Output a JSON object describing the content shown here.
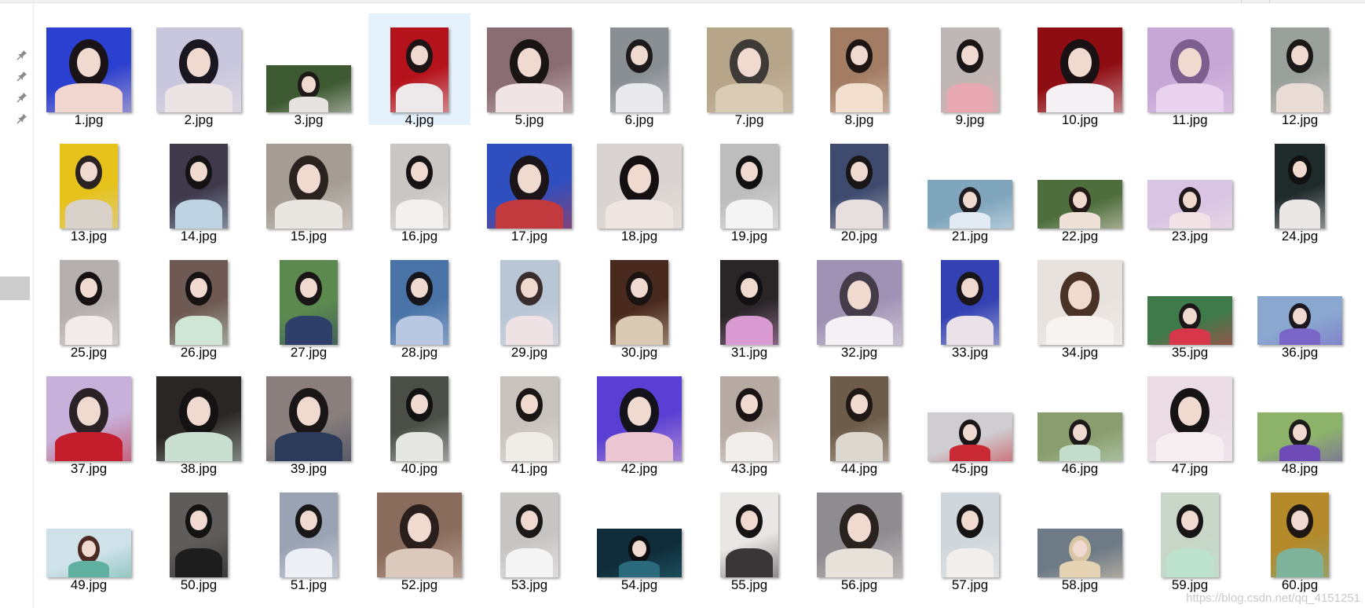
{
  "explorer": {
    "nav_pins": [
      "pin-icon",
      "pin-icon",
      "pin-icon",
      "pin-icon"
    ],
    "selected_file": "4.jpg",
    "watermark": "https://blog.csdn.net/qq_4151251"
  },
  "files": [
    {
      "name": "1.jpg",
      "shape": "sq",
      "bg": "#2b3fd0",
      "fg": "#f1d6d0",
      "hair": "#1a1418"
    },
    {
      "name": "2.jpg",
      "shape": "sq",
      "bg": "#c9c7de",
      "fg": "#ece3e4",
      "hair": "#1b1720"
    },
    {
      "name": "3.jpg",
      "shape": "land",
      "bg": "#3d5a32",
      "fg": "#e6e2df",
      "hair": "#1d1a18"
    },
    {
      "name": "4.jpg",
      "shape": "port",
      "bg": "#b5131c",
      "fg": "#ede9ea",
      "hair": "#1d1416"
    },
    {
      "name": "5.jpg",
      "shape": "sq",
      "bg": "#8a6d72",
      "fg": "#f1e4e6",
      "hair": "#1a1515"
    },
    {
      "name": "6.jpg",
      "shape": "port",
      "bg": "#8a8f93",
      "fg": "#e9e8ec",
      "hair": "#1e1a1c"
    },
    {
      "name": "7.jpg",
      "shape": "sq",
      "bg": "#b7a58a",
      "fg": "#d9cbb4",
      "hair": "#3d3a38"
    },
    {
      "name": "8.jpg",
      "shape": "port",
      "bg": "#a27c63",
      "fg": "#f2dfcf",
      "hair": "#1f1614"
    },
    {
      "name": "9.jpg",
      "shape": "port",
      "bg": "#bfb7b5",
      "fg": "#e7a8b1",
      "hair": "#1a1617"
    },
    {
      "name": "10.jpg",
      "shape": "sq",
      "bg": "#8e0d13",
      "fg": "#f4f0f4",
      "hair": "#1a1114"
    },
    {
      "name": "11.jpg",
      "shape": "sq",
      "bg": "#c7a7d6",
      "fg": "#e9d2ee",
      "hair": "#7d5f8f"
    },
    {
      "name": "12.jpg",
      "shape": "port",
      "bg": "#9aa09c",
      "fg": "#e8dcd5",
      "hair": "#1b1918"
    },
    {
      "name": "13.jpg",
      "shape": "port",
      "bg": "#e6c21a",
      "fg": "#d8d2ca",
      "hair": "#2a2321"
    },
    {
      "name": "14.jpg",
      "shape": "port",
      "bg": "#3e3a4c",
      "fg": "#bdd3e1",
      "hair": "#151214"
    },
    {
      "name": "15.jpg",
      "shape": "sq",
      "bg": "#a59d93",
      "fg": "#e9e6e2",
      "hair": "#2b2320"
    },
    {
      "name": "16.jpg",
      "shape": "port",
      "bg": "#c9c6c4",
      "fg": "#f3f1ef",
      "hair": "#171314"
    },
    {
      "name": "17.jpg",
      "shape": "sq",
      "bg": "#2f4fbf",
      "fg": "#c23a3e",
      "hair": "#1b1519"
    },
    {
      "name": "18.jpg",
      "shape": "sq",
      "bg": "#d9d4d1",
      "fg": "#efe6e2",
      "hair": "#141012"
    },
    {
      "name": "19.jpg",
      "shape": "port",
      "bg": "#bdbdbd",
      "fg": "#f4f4f4",
      "hair": "#121112"
    },
    {
      "name": "20.jpg",
      "shape": "port",
      "bg": "#3e4b6e",
      "fg": "#e7dede",
      "hair": "#1a1517"
    },
    {
      "name": "21.jpg",
      "shape": "wide",
      "bg": "#7fa6bd",
      "fg": "#e2ebf1",
      "hair": "#1f1d22"
    },
    {
      "name": "22.jpg",
      "shape": "wide",
      "bg": "#4f6e3e",
      "fg": "#efe1d8",
      "hair": "#231a17"
    },
    {
      "name": "23.jpg",
      "shape": "wide",
      "bg": "#d9c5e3",
      "fg": "#f3e3e6",
      "hair": "#1f191c"
    },
    {
      "name": "24.jpg",
      "shape": "tall",
      "bg": "#1f2a2a",
      "fg": "#ece7e7",
      "hair": "#111011"
    },
    {
      "name": "25.jpg",
      "shape": "port",
      "bg": "#b5b0ae",
      "fg": "#f1ecea",
      "hair": "#161213"
    },
    {
      "name": "26.jpg",
      "shape": "port",
      "bg": "#6e5a52",
      "fg": "#cfe6d6",
      "hair": "#171314"
    },
    {
      "name": "27.jpg",
      "shape": "port",
      "bg": "#5c8a4e",
      "fg": "#2f3f6a",
      "hair": "#1a1517"
    },
    {
      "name": "28.jpg",
      "shape": "port",
      "bg": "#4a74a8",
      "fg": "#b9c8e2",
      "hair": "#16151b"
    },
    {
      "name": "29.jpg",
      "shape": "port",
      "bg": "#b8c6d6",
      "fg": "#eee2e4",
      "hair": "#3b2d2e"
    },
    {
      "name": "30.jpg",
      "shape": "port",
      "bg": "#4a2a1e",
      "fg": "#d9c9b2",
      "hair": "#1b1412"
    },
    {
      "name": "31.jpg",
      "shape": "port",
      "bg": "#2a2628",
      "fg": "#d89ad0",
      "hair": "#121012"
    },
    {
      "name": "32.jpg",
      "shape": "sq",
      "bg": "#9f92b4",
      "fg": "#f3f1f3",
      "hair": "#453c4a"
    },
    {
      "name": "33.jpg",
      "shape": "port",
      "bg": "#3341b3",
      "fg": "#eae2e8",
      "hair": "#1a1519"
    },
    {
      "name": "34.jpg",
      "shape": "sq",
      "bg": "#e8e2de",
      "fg": "#f6f3f1",
      "hair": "#4a3226"
    },
    {
      "name": "35.jpg",
      "shape": "wide",
      "bg": "#3f7a4a",
      "fg": "#d8364a",
      "hair": "#1b1719"
    },
    {
      "name": "36.jpg",
      "shape": "wide",
      "bg": "#8aa7d0",
      "fg": "#7a66c7",
      "hair": "#1d1820"
    },
    {
      "name": "37.jpg",
      "shape": "sq",
      "bg": "#c7b1da",
      "fg": "#c41e2c",
      "hair": "#2b2226"
    },
    {
      "name": "38.jpg",
      "shape": "sq",
      "bg": "#2a2624",
      "fg": "#c9dfd1",
      "hair": "#151213"
    },
    {
      "name": "39.jpg",
      "shape": "sq",
      "bg": "#8a7f7c",
      "fg": "#2d3b5a",
      "hair": "#1a1516"
    },
    {
      "name": "40.jpg",
      "shape": "port",
      "bg": "#4b4f48",
      "fg": "#e6e6e3",
      "hair": "#121212"
    },
    {
      "name": "41.jpg",
      "shape": "port",
      "bg": "#c9c3bd",
      "fg": "#f0ece8",
      "hair": "#1b1616"
    },
    {
      "name": "42.jpg",
      "shape": "sq",
      "bg": "#5a3fd4",
      "fg": "#ebc6d2",
      "hair": "#14121a"
    },
    {
      "name": "43.jpg",
      "shape": "port",
      "bg": "#b7aaa3",
      "fg": "#f2eeec",
      "hair": "#1a1415"
    },
    {
      "name": "44.jpg",
      "shape": "port",
      "bg": "#6d5c49",
      "fg": "#dcd7cf",
      "hair": "#1f1815"
    },
    {
      "name": "45.jpg",
      "shape": "wide",
      "bg": "#cfcdd1",
      "fg": "#c92a33",
      "hair": "#1a1516"
    },
    {
      "name": "46.jpg",
      "shape": "wide",
      "bg": "#8a9d6e",
      "fg": "#c3dccb",
      "hair": "#1e1a19"
    },
    {
      "name": "47.jpg",
      "shape": "sq",
      "bg": "#eadbe4",
      "fg": "#f7eef2",
      "hair": "#161314"
    },
    {
      "name": "48.jpg",
      "shape": "wide",
      "bg": "#8db36a",
      "fg": "#6f4bb8",
      "hair": "#1d1a1b"
    },
    {
      "name": "49.jpg",
      "shape": "wide",
      "bg": "#cfe2ea",
      "fg": "#5fb09f",
      "hair": "#4a2a23"
    },
    {
      "name": "50.jpg",
      "shape": "port",
      "bg": "#5f5d5b",
      "fg": "#1d1d1d",
      "hair": "#141313"
    },
    {
      "name": "51.jpg",
      "shape": "port",
      "bg": "#9aa3b3",
      "fg": "#eceff4",
      "hair": "#1a1718"
    },
    {
      "name": "52.jpg",
      "shape": "sq",
      "bg": "#8a6c5c",
      "fg": "#dcc9bd",
      "hair": "#2a1f1c"
    },
    {
      "name": "53.jpg",
      "shape": "port",
      "bg": "#c7c5c3",
      "fg": "#f4f4f4",
      "hair": "#1b1818"
    },
    {
      "name": "54.jpg",
      "shape": "wide",
      "bg": "#0f2d3a",
      "fg": "#2b6a7c",
      "hair": "#0b0d10"
    },
    {
      "name": "55.jpg",
      "shape": "port",
      "bg": "#e9e7e6",
      "fg": "#3a3638",
      "hair": "#161314"
    },
    {
      "name": "56.jpg",
      "shape": "sq",
      "bg": "#8e8c91",
      "fg": "#e8e1da",
      "hair": "#2a221f"
    },
    {
      "name": "57.jpg",
      "shape": "port",
      "bg": "#cfd7dc",
      "fg": "#f2eeec",
      "hair": "#171415"
    },
    {
      "name": "58.jpg",
      "shape": "wide",
      "bg": "#6e7a86",
      "fg": "#e6d3b4",
      "hair": "#d8c5a4"
    },
    {
      "name": "59.jpg",
      "shape": "port",
      "bg": "#c8d6c8",
      "fg": "#bde3cf",
      "hair": "#181517"
    },
    {
      "name": "60.jpg",
      "shape": "port",
      "bg": "#b48a2a",
      "fg": "#7fb29a",
      "hair": "#1f1712"
    }
  ]
}
